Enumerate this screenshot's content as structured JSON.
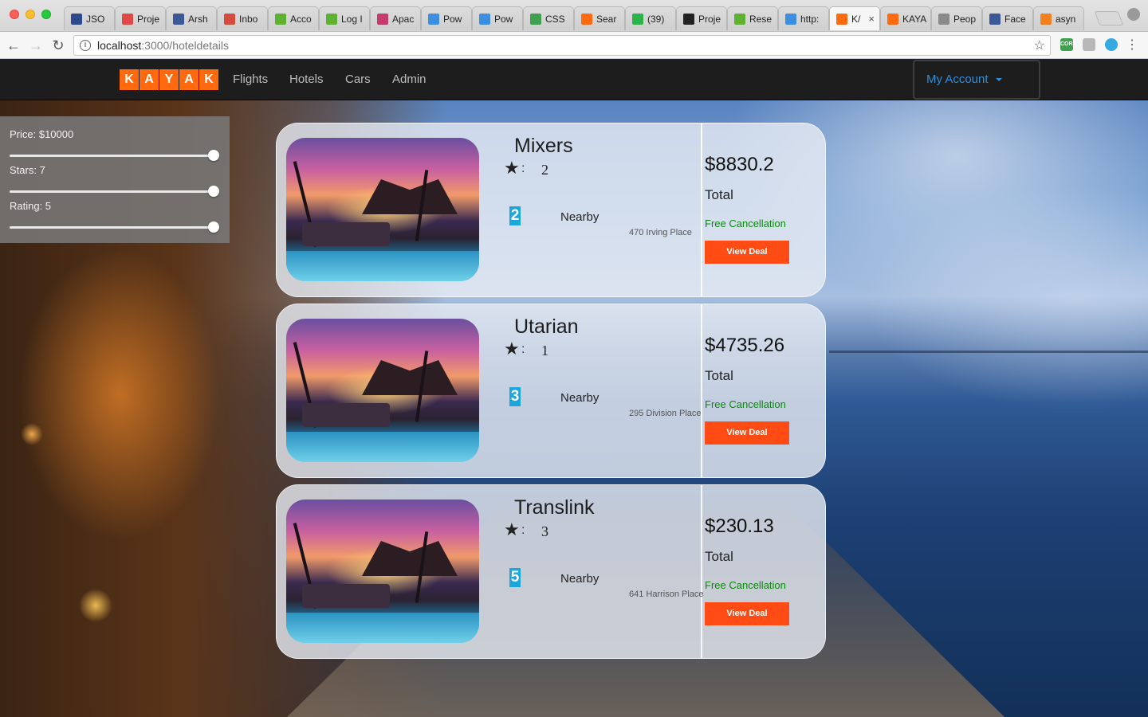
{
  "browser": {
    "tabs": [
      {
        "label": "JSO",
        "icon": "jsonlint-icon",
        "color": "#2c4b8c"
      },
      {
        "label": "Proje",
        "icon": "project-icon",
        "color": "#e04848"
      },
      {
        "label": "Arsh",
        "icon": "facebook-icon",
        "color": "#3b5998"
      },
      {
        "label": "Inbo",
        "icon": "gmail-icon",
        "color": "#d54b3d"
      },
      {
        "label": "Acco",
        "icon": "leaf-icon",
        "color": "#5fb130"
      },
      {
        "label": "Log I",
        "icon": "leaf-icon",
        "color": "#5fb130"
      },
      {
        "label": "Apac",
        "icon": "feather-icon",
        "color": "#c43b6e"
      },
      {
        "label": "Pow",
        "icon": "p-icon",
        "color": "#3a8fe0"
      },
      {
        "label": "Pow",
        "icon": "p-icon",
        "color": "#3a8fe0"
      },
      {
        "label": "CSS",
        "icon": "css-icon",
        "color": "#3fa14d"
      },
      {
        "label": "Sear",
        "icon": "kayak-icon",
        "color": "#ff690f"
      },
      {
        "label": "(39)",
        "icon": "whatsapp-icon",
        "color": "#2bb34a"
      },
      {
        "label": "Proje",
        "icon": "github-icon",
        "color": "#222222"
      },
      {
        "label": "Rese",
        "icon": "leaf-icon",
        "color": "#5fb130"
      },
      {
        "label": "http:",
        "icon": "p-icon",
        "color": "#3a8fe0"
      },
      {
        "label": "K/",
        "icon": "kayak-icon",
        "color": "#ff690f",
        "active": true
      },
      {
        "label": "KAYA",
        "icon": "kayak-icon",
        "color": "#ff690f"
      },
      {
        "label": "Peop",
        "icon": "document-icon",
        "color": "#8a8a8a"
      },
      {
        "label": "Face",
        "icon": "facebook-icon",
        "color": "#3b5998"
      },
      {
        "label": "asyn",
        "icon": "stack-icon",
        "color": "#f48024"
      }
    ],
    "url_host": "localhost",
    "url_path": ":3000/hoteldetails"
  },
  "nav": {
    "logo_letters": [
      "K",
      "A",
      "Y",
      "A",
      "K"
    ],
    "links": [
      "Flights",
      "Hotels",
      "Cars",
      "Admin"
    ],
    "account_label": "My Account"
  },
  "filters": {
    "price_label": "Price: $10000",
    "stars_label": "Stars: 7",
    "rating_label": "Rating: 5",
    "price_fraction": 1.0,
    "stars_fraction": 1.0,
    "rating_fraction": 1.0
  },
  "hotels": [
    {
      "name": "Mixers",
      "stars": "2",
      "rating": "2",
      "nearby": "Nearby",
      "address": "470 Irving Place",
      "price": "$8830.2",
      "total": "Total",
      "cancel": "Free Cancellation",
      "deal": "View Deal"
    },
    {
      "name": "Utarian",
      "stars": "1",
      "rating": "3",
      "nearby": "Nearby",
      "address": "295 Division Place",
      "price": "$4735.26",
      "total": "Total",
      "cancel": "Free Cancellation",
      "deal": "View Deal"
    },
    {
      "name": "Translink",
      "stars": "3",
      "rating": "5",
      "nearby": "Nearby",
      "address": "641 Harrison Place",
      "price": "$230.13",
      "total": "Total",
      "cancel": "Free Cancellation",
      "deal": "View Deal"
    }
  ],
  "colors": {
    "brand": "#ff690f",
    "accent": "#2f8fdc",
    "deal_button": "#ff4b14",
    "cancel_text": "#0a8a0a",
    "badge": "#1ba6dc"
  }
}
